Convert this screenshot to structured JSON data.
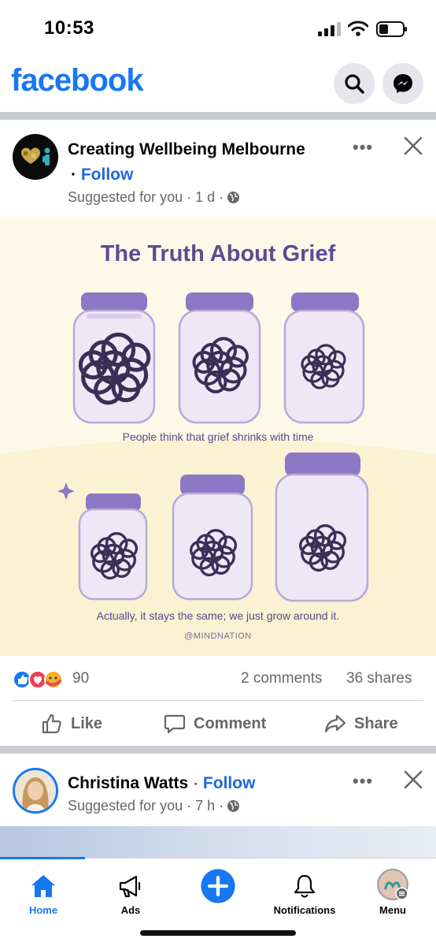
{
  "status_bar": {
    "time": "10:53"
  },
  "header": {
    "logo": "facebook",
    "search_icon": "search-icon",
    "messenger_icon": "messenger-icon"
  },
  "post1": {
    "author": "Creating Wellbeing Melbourne",
    "follow_prefix": "·",
    "follow": "Follow",
    "meta": "Suggested for you · 1 d ·",
    "more": "•••",
    "image": {
      "title": "The Truth About Grief",
      "caption_top": "People think that grief shrinks with time",
      "caption_bottom": "Actually, it stays the same; we just grow around it.",
      "credit": "@MINDNATION"
    },
    "reaction_count": "90",
    "comments": "2 comments",
    "shares": "36 shares",
    "actions": {
      "like": "Like",
      "comment": "Comment",
      "share": "Share"
    }
  },
  "post2": {
    "author": "Christina Watts",
    "follow_prefix": "·",
    "follow": "Follow",
    "meta": "Suggested for you · 7 h ·",
    "more": "•••"
  },
  "bottom_nav": {
    "items": [
      {
        "label": "Home",
        "icon": "home-icon",
        "active": true
      },
      {
        "label": "Ads",
        "icon": "megaphone-icon"
      },
      {
        "label": "",
        "icon": "plus-icon"
      },
      {
        "label": "Notifications",
        "icon": "bell-icon"
      },
      {
        "label": "Menu",
        "icon": "profile-menu-icon"
      }
    ]
  },
  "colors": {
    "brand": "#1877f2",
    "follow": "#1b6ad7",
    "grief_purple": "#5f4a94"
  }
}
